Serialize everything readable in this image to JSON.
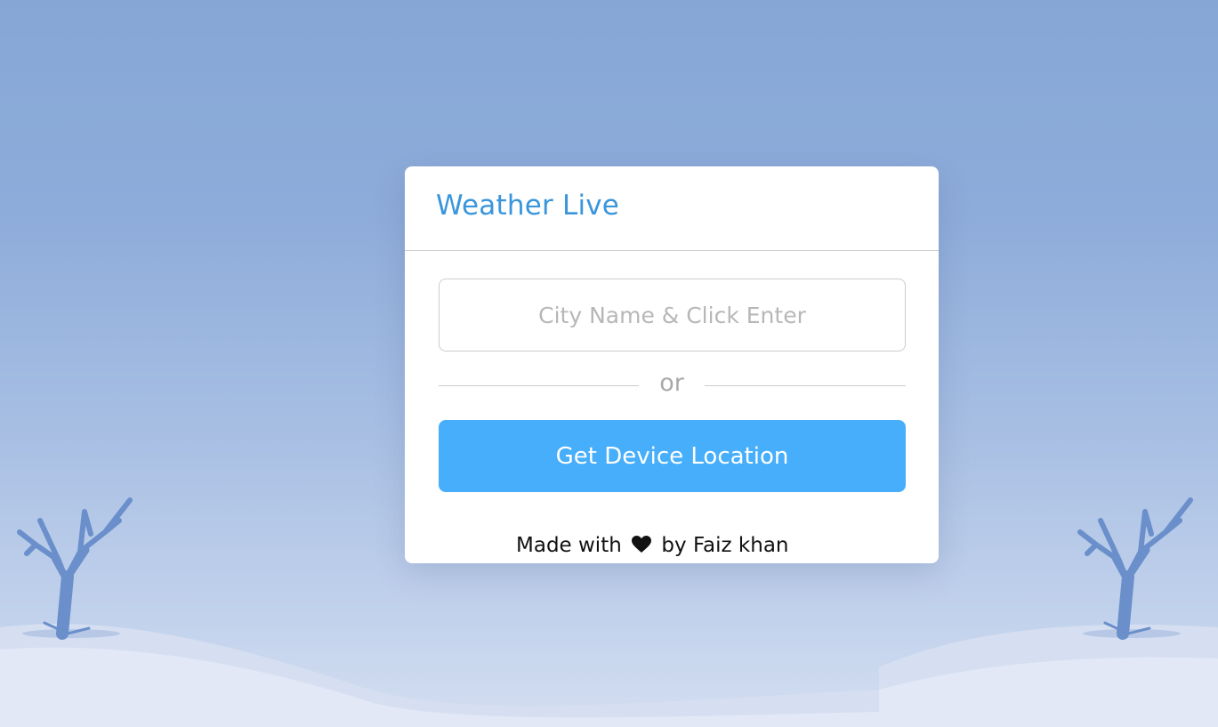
{
  "app": {
    "title": "Weather Live"
  },
  "search": {
    "placeholder": "City Name & Click Enter",
    "value": ""
  },
  "separator": {
    "label": "or"
  },
  "location_button": {
    "label": "Get Device Location"
  },
  "credit": {
    "prefix": "Made with",
    "icon": "heart-icon",
    "suffix": "by Faiz khan"
  },
  "colors": {
    "accent": "#3a96dc",
    "button": "#46aefa",
    "background_sky": "#86a7d6",
    "tree": "#6a8fcb",
    "snow": "#dce4f4"
  }
}
